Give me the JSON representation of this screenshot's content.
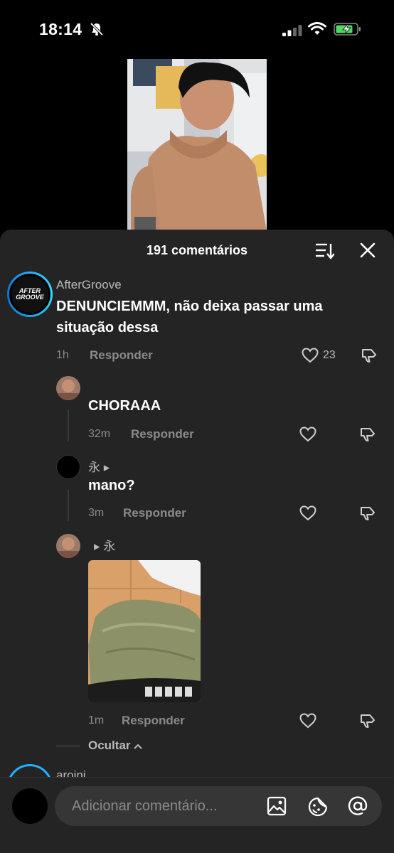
{
  "status_bar": {
    "time": "18:14",
    "icons": [
      "bell-off-icon",
      "signal-icon",
      "wifi-icon",
      "battery-charging-icon"
    ],
    "battery_color": "#4cd964"
  },
  "sheet": {
    "title": "191 comentários",
    "icons": [
      "sort-icon",
      "close-icon"
    ]
  },
  "comments": [
    {
      "username": "AfterGroove",
      "avatar_text": [
        "AFTER",
        "GROOVE"
      ],
      "text_line1": "DENUNCIEMMM, não deixa passar uma",
      "text_line2": "situação dessa",
      "time": "1h",
      "reply_label": "Responder",
      "likes": "23"
    }
  ],
  "replies": [
    {
      "username": "",
      "text": "CHORAAA",
      "time": "32m",
      "reply_label": "Responder"
    },
    {
      "username": "永 ▸",
      "text": "mano?",
      "time": "3m",
      "reply_label": "Responder"
    },
    {
      "username": "▸ 永",
      "text": "",
      "time": "1m",
      "reply_label": "Responder",
      "has_image": true
    }
  ],
  "hide_label": "Ocultar",
  "next_comment_username": "aroini",
  "input": {
    "placeholder": "Adicionar comentário..."
  },
  "colors": {
    "sheet_bg": "#242424",
    "accent_ring": "#20b3ff",
    "muted_text": "#8a8a8a"
  }
}
